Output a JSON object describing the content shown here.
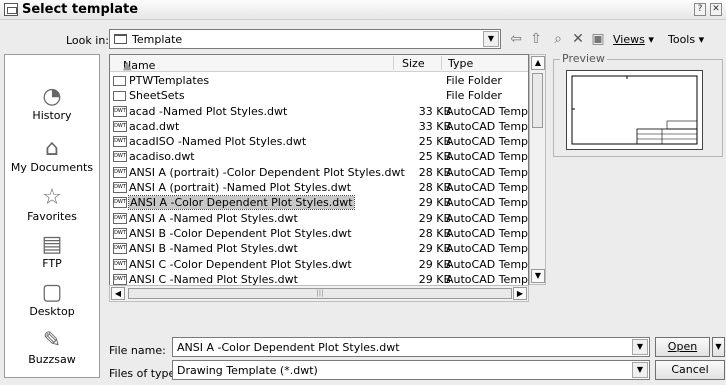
{
  "window": {
    "title": "Select template"
  },
  "toolbar": {
    "look_in_label": "Look in:",
    "look_in_value": "Template",
    "views_label": "Views",
    "tools_label": "Tools"
  },
  "places": [
    {
      "label": "History",
      "icon": "history-icon"
    },
    {
      "label": "My Documents",
      "icon": "my-documents-icon"
    },
    {
      "label": "Favorites",
      "icon": "favorites-icon"
    },
    {
      "label": "FTP",
      "icon": "ftp-icon"
    },
    {
      "label": "Desktop",
      "icon": "desktop-icon"
    },
    {
      "label": "Buzzsaw",
      "icon": "buzzsaw-icon"
    }
  ],
  "file_list": {
    "columns": {
      "name": "Name",
      "size": "Size",
      "type": "Type"
    },
    "rows": [
      {
        "name": "PTWTemplates",
        "size": "",
        "type": "File Folder",
        "kind": "folder"
      },
      {
        "name": "SheetSets",
        "size": "",
        "type": "File Folder",
        "kind": "folder"
      },
      {
        "name": "acad -Named Plot Styles.dwt",
        "size": "33 KB",
        "type": "AutoCAD Template",
        "kind": "dwt"
      },
      {
        "name": "acad.dwt",
        "size": "33 KB",
        "type": "AutoCAD Template",
        "kind": "dwt"
      },
      {
        "name": "acadISO -Named Plot Styles.dwt",
        "size": "25 KB",
        "type": "AutoCAD Template",
        "kind": "dwt"
      },
      {
        "name": "acadiso.dwt",
        "size": "25 KB",
        "type": "AutoCAD Template",
        "kind": "dwt"
      },
      {
        "name": "ANSI A (portrait) -Color Dependent Plot Styles.dwt",
        "size": "28 KB",
        "type": "AutoCAD Template",
        "kind": "dwt"
      },
      {
        "name": "ANSI A (portrait) -Named Plot Styles.dwt",
        "size": "28 KB",
        "type": "AutoCAD Template",
        "kind": "dwt"
      },
      {
        "name": "ANSI A -Color Dependent Plot Styles.dwt",
        "size": "29 KB",
        "type": "AutoCAD Template",
        "kind": "dwt",
        "selected": true
      },
      {
        "name": "ANSI A -Named Plot Styles.dwt",
        "size": "29 KB",
        "type": "AutoCAD Template",
        "kind": "dwt"
      },
      {
        "name": "ANSI B -Color Dependent Plot Styles.dwt",
        "size": "28 KB",
        "type": "AutoCAD Template",
        "kind": "dwt"
      },
      {
        "name": "ANSI B -Named Plot Styles.dwt",
        "size": "29 KB",
        "type": "AutoCAD Template",
        "kind": "dwt"
      },
      {
        "name": "ANSI C -Color Dependent Plot Styles.dwt",
        "size": "29 KB",
        "type": "AutoCAD Template",
        "kind": "dwt"
      },
      {
        "name": "ANSI C -Named Plot Styles.dwt",
        "size": "29 KB",
        "type": "AutoCAD Template",
        "kind": "dwt"
      }
    ],
    "icon_text": "DWT"
  },
  "preview": {
    "label": "Preview"
  },
  "footer": {
    "file_name_label": "File name:",
    "file_name_value": "ANSI A -Color Dependent Plot Styles.dwt",
    "file_type_label": "Files of type:",
    "file_type_value": "Drawing Template (*.dwt)",
    "open_label": "Open",
    "cancel_label": "Cancel"
  }
}
